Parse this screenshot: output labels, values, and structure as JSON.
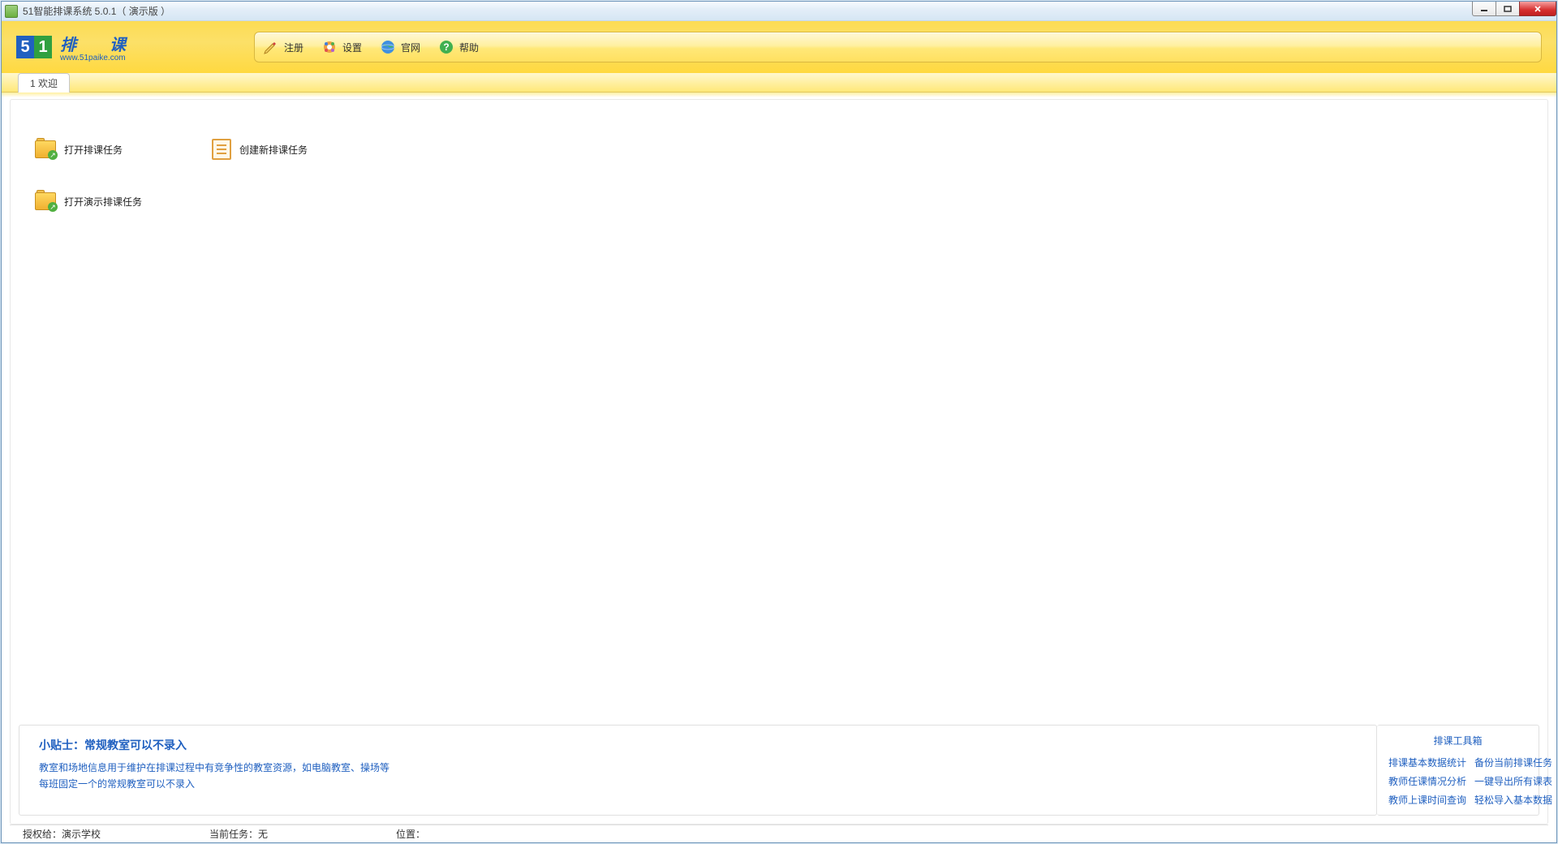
{
  "window": {
    "title": "51智能排课系统 5.0.1（ 演示版 ）"
  },
  "logo": {
    "five": "5",
    "one": "1",
    "title": "排 课",
    "url": "www.51paike.com"
  },
  "toolbar": {
    "register": "注册",
    "settings": "设置",
    "website": "官网",
    "help": "帮助"
  },
  "tabs": {
    "welcome": "1 欢迎"
  },
  "actions": {
    "open_task": "打开排课任务",
    "new_task": "创建新排课任务",
    "open_demo": "打开演示排课任务"
  },
  "tips": {
    "title": "小贴士：常规教室可以不录入",
    "line1": "教室和场地信息用于维护在排课过程中有竞争性的教室资源，如电脑教室、操场等",
    "line2": "每班固定一个的常规教室可以不录入"
  },
  "toolbox": {
    "title": "排课工具箱",
    "links": [
      "排课基本数据统计",
      "备份当前排课任务",
      "教师任课情况分析",
      "一键导出所有课表",
      "教师上课时间查询",
      "轻松导入基本数据"
    ]
  },
  "status": {
    "licensed_label": "授权给：",
    "licensed_value": "演示学校",
    "task_label": "当前任务：",
    "task_value": "无",
    "position_label": "位置："
  }
}
